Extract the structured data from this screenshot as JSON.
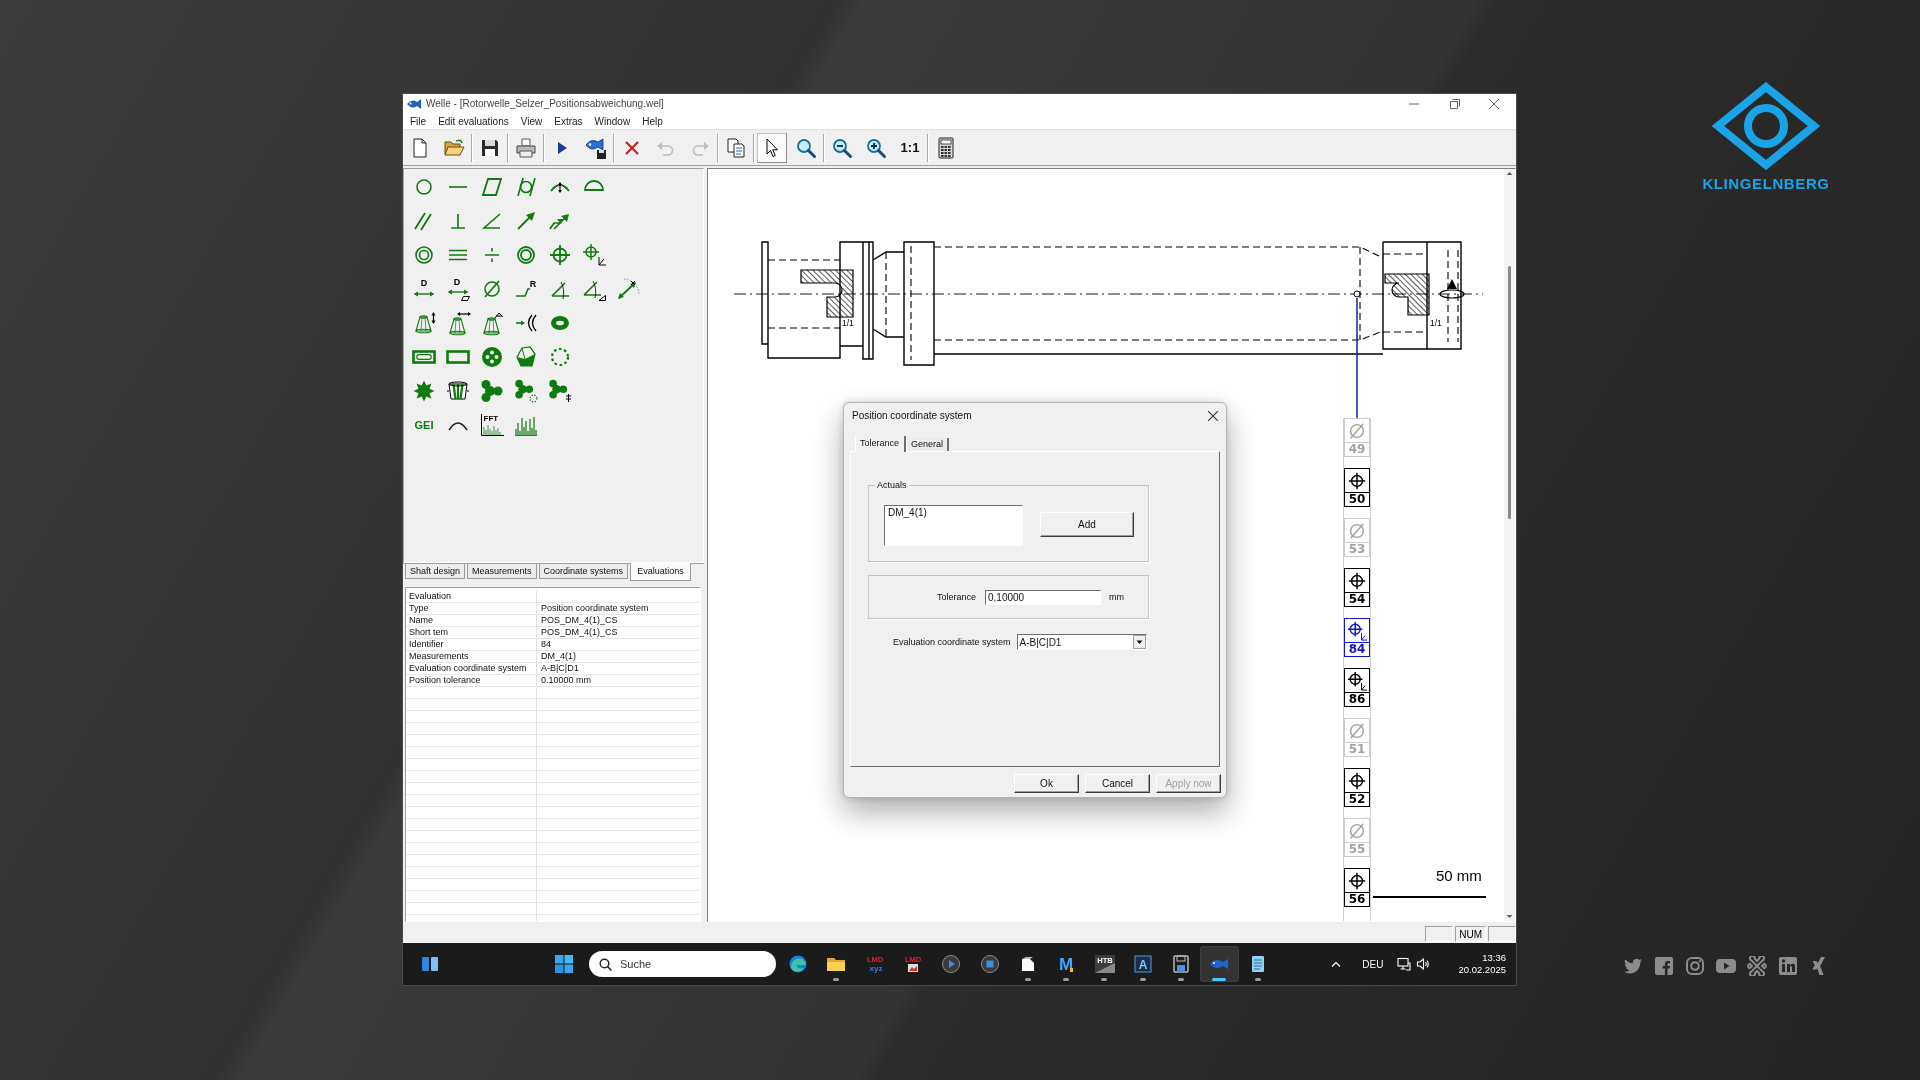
{
  "window": {
    "title": "Welle - [Rotorwelle_Selzer_Positionsabweichung.wel]"
  },
  "menu": [
    "File",
    "Edit evaluations",
    "View",
    "Extras",
    "Window",
    "Help"
  ],
  "toolbar": [
    [
      {
        "kind": "new-document",
        "selected": false,
        "disabled": false
      },
      {
        "kind": "open-folder",
        "selected": false,
        "disabled": false
      }
    ],
    [
      {
        "kind": "save",
        "selected": false,
        "disabled": false
      }
    ],
    [
      {
        "kind": "printer",
        "selected": false,
        "disabled": false
      }
    ],
    [
      {
        "kind": "play",
        "selected": false,
        "disabled": false
      },
      {
        "kind": "fish-disk",
        "selected": false,
        "disabled": false
      }
    ],
    [
      {
        "kind": "delete",
        "selected": false,
        "disabled": false
      },
      {
        "kind": "undo",
        "selected": false,
        "disabled": true
      },
      {
        "kind": "redo",
        "selected": false,
        "disabled": true
      }
    ],
    [
      {
        "kind": "copy",
        "selected": false,
        "disabled": false
      }
    ],
    [
      {
        "kind": "pointer",
        "selected": true,
        "disabled": false
      },
      {
        "kind": "zoom",
        "selected": false,
        "disabled": false
      }
    ],
    [
      {
        "kind": "zoom-out",
        "selected": false,
        "disabled": false
      },
      {
        "kind": "zoom-in",
        "selected": false,
        "disabled": false
      },
      {
        "kind": "actual-size",
        "label": "1:1",
        "selected": false,
        "disabled": false
      }
    ],
    [
      {
        "kind": "calculator",
        "selected": false,
        "disabled": false
      }
    ]
  ],
  "palette": [
    [
      {
        "kind": "circle"
      },
      {
        "kind": "line"
      },
      {
        "kind": "parallelogram"
      },
      {
        "kind": "cylinder"
      },
      {
        "kind": "arc-arrow"
      },
      {
        "kind": "half-circle"
      }
    ],
    [
      {
        "kind": "parallel-lines"
      },
      {
        "kind": "perpendicular"
      },
      {
        "kind": "angle"
      },
      {
        "kind": "arrow"
      },
      {
        "kind": "double-arrow"
      }
    ],
    [
      {
        "kind": "concentric-circles"
      },
      {
        "kind": "triple-line"
      },
      {
        "kind": "divide"
      },
      {
        "kind": "double-circle"
      },
      {
        "kind": "crosshair"
      },
      {
        "kind": "crosshair-axes"
      }
    ],
    [
      {
        "kind": "distance",
        "label": "D"
      },
      {
        "kind": "distance-parallelogram",
        "label": "D"
      },
      {
        "kind": "diameter"
      },
      {
        "kind": "step-radius",
        "label": "R"
      },
      {
        "kind": "angle-arc"
      },
      {
        "kind": "angle-triangle"
      },
      {
        "kind": "radial-arrow"
      }
    ],
    [
      {
        "kind": "cone-height"
      },
      {
        "kind": "cone-width"
      },
      {
        "kind": "cone-angle"
      },
      {
        "kind": "arrow-arcs"
      },
      {
        "kind": "ring"
      }
    ],
    [
      {
        "kind": "slot"
      },
      {
        "kind": "rectangle"
      },
      {
        "kind": "four-holes"
      },
      {
        "kind": "polyhedron"
      },
      {
        "kind": "dashed-circle"
      }
    ],
    [
      {
        "kind": "gear"
      },
      {
        "kind": "spur-gear"
      },
      {
        "kind": "trefoil"
      },
      {
        "kind": "trefoil-dotted"
      },
      {
        "kind": "trefoil-marks"
      }
    ],
    [
      {
        "kind": "text",
        "label": "GEI"
      },
      {
        "kind": "arc"
      },
      {
        "kind": "fft-chart",
        "label": "FFT"
      },
      {
        "kind": "spectrum"
      }
    ]
  ],
  "side_tabs": [
    {
      "label": "Shaft design",
      "selected": false
    },
    {
      "label": "Measurements",
      "selected": false
    },
    {
      "label": "Coordinate systems",
      "selected": false
    },
    {
      "label": "Evaluations",
      "selected": true
    }
  ],
  "properties": {
    "heading": "Evaluation",
    "rows": [
      {
        "name": "Type",
        "value": "Position coordinate system"
      },
      {
        "name": "Name",
        "value": "POS_DM_4(1)_CS"
      },
      {
        "name": "Short tem",
        "value": "POS_DM_4(1)_CS"
      },
      {
        "name": "Identifier",
        "value": "84"
      },
      {
        "name": "Measurements",
        "value": "DM_4(1)"
      },
      {
        "name": "Evaluation coordinate system",
        "value": "A-B|C|D1"
      },
      {
        "name": "Position tolerance",
        "value": "0.10000 mm"
      }
    ]
  },
  "drawing": {
    "section_labels": [
      "1/1",
      "1/1"
    ],
    "features": [
      {
        "number": "49",
        "kind": "diameter",
        "disabled": true,
        "selected": false
      },
      {
        "number": "50",
        "kind": "crosshair",
        "disabled": false,
        "selected": false
      },
      {
        "number": "53",
        "kind": "diameter",
        "disabled": true,
        "selected": false
      },
      {
        "number": "54",
        "kind": "crosshair",
        "disabled": false,
        "selected": false
      },
      {
        "number": "84",
        "kind": "crosshair-axes",
        "disabled": false,
        "selected": true
      },
      {
        "number": "86",
        "kind": "crosshair-axes",
        "disabled": false,
        "selected": false
      },
      {
        "number": "51",
        "kind": "diameter",
        "disabled": true,
        "selected": false
      },
      {
        "number": "52",
        "kind": "crosshair",
        "disabled": false,
        "selected": false
      },
      {
        "number": "55",
        "kind": "diameter",
        "disabled": true,
        "selected": false
      },
      {
        "number": "56",
        "kind": "crosshair",
        "disabled": false,
        "selected": false
      }
    ],
    "scale": "50 mm"
  },
  "dialog": {
    "title": "Position coordinate system",
    "tabs": [
      {
        "label": "Tolerance",
        "selected": true
      },
      {
        "label": "General",
        "selected": false
      }
    ],
    "actuals": {
      "legend": "Actuals",
      "items": [
        "DM_4(1)"
      ],
      "button": "Add"
    },
    "tolerance": {
      "label": "Tolerance",
      "value": "0.10000",
      "unit": "mm"
    },
    "coordinate_system": {
      "label": "Evaluation coordinate system",
      "value": "A-B|C|D1"
    },
    "buttons": [
      {
        "label": "Ok",
        "disabled": false
      },
      {
        "label": "Cancel",
        "disabled": false
      },
      {
        "label": "Apply now",
        "disabled": true
      }
    ]
  },
  "status_bar": {
    "indicators": [
      "NUM"
    ]
  },
  "taskbar": {
    "search": {
      "placeholder": "Suche"
    },
    "apps": [
      {
        "kind": "browser",
        "running": false,
        "active": false
      },
      {
        "kind": "folder",
        "running": true,
        "active": false
      },
      {
        "kind": "text-logo",
        "label": "LMD",
        "sublabel": "xyz",
        "running": false,
        "active": false
      },
      {
        "kind": "text-logo",
        "label": "LMD",
        "running": false,
        "active": false
      },
      {
        "kind": "play-circle",
        "running": false,
        "active": false
      },
      {
        "kind": "stop-circle",
        "running": false,
        "active": false
      },
      {
        "kind": "document",
        "running": true,
        "active": false
      },
      {
        "kind": "letter-logo",
        "label": "M",
        "running": true,
        "active": false
      },
      {
        "kind": "text-tile",
        "label": "HTB",
        "running": true,
        "active": false
      },
      {
        "kind": "letter-tile",
        "label": "A",
        "running": true,
        "active": false
      },
      {
        "kind": "floppy",
        "running": true,
        "active": false
      },
      {
        "kind": "fish",
        "running": true,
        "active": true
      },
      {
        "kind": "notepad",
        "running": true,
        "active": false
      }
    ],
    "language": "DEU",
    "clock": {
      "time": "13:36",
      "date": "20.02.2025"
    }
  },
  "brand": {
    "name": "KLINGELNBERG"
  },
  "social": [
    {
      "kind": "bird"
    },
    {
      "kind": "f-square"
    },
    {
      "kind": "camera"
    },
    {
      "kind": "play-tile"
    },
    {
      "kind": "looped-cross"
    },
    {
      "kind": "in-square"
    },
    {
      "kind": "zigzag"
    }
  ]
}
